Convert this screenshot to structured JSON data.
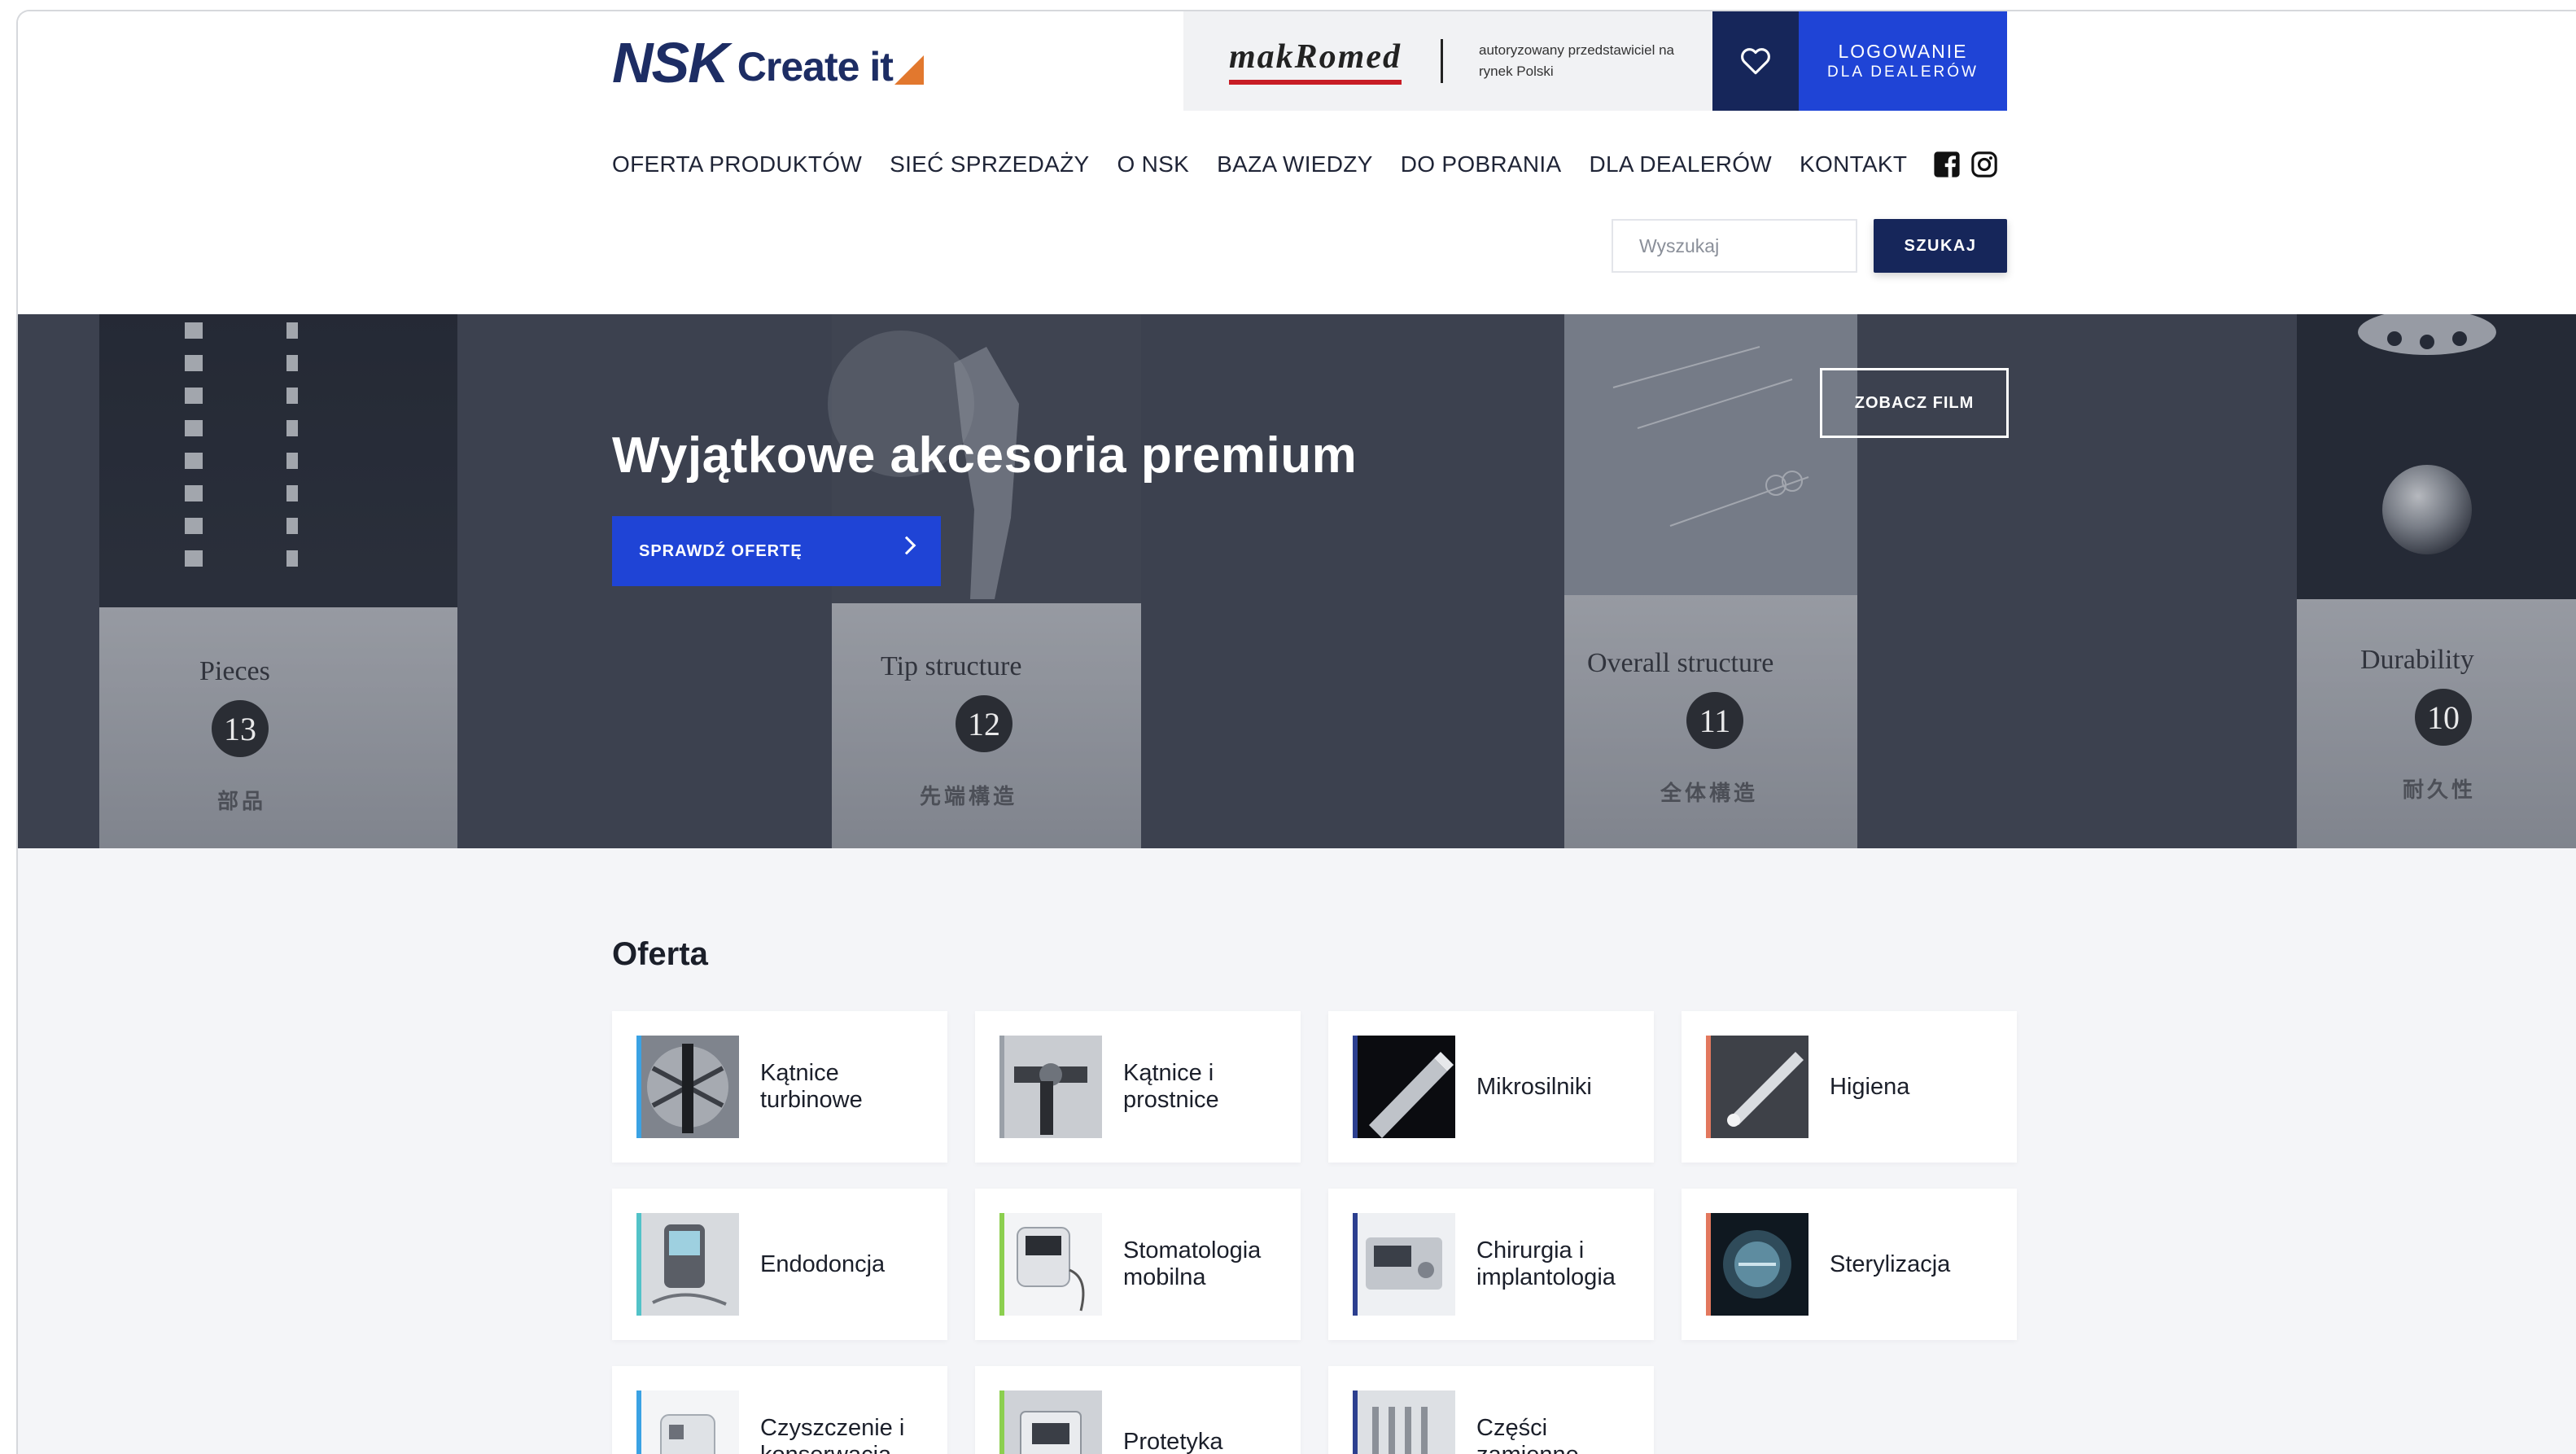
{
  "brand": {
    "logo_main": "NSK",
    "logo_sub": "Create it",
    "partner_logo": "makRomed",
    "partner_text": "autoryzowany przedstawiciel na rynek Polski"
  },
  "header": {
    "login_line1": "LOGOWANIE",
    "login_line2": "DLA DEALERÓW",
    "search_placeholder": "Wyszukaj",
    "search_button": "SZUKAJ"
  },
  "nav": {
    "items": [
      "OFERTA PRODUKTÓW",
      "SIEĆ SPRZEDAŻY",
      "O NSK",
      "BAZA WIEDZY",
      "DO POBRANIA",
      "DLA DEALERÓW",
      "KONTAKT"
    ]
  },
  "hero": {
    "title": "Wyjątkowe akcesoria premium",
    "cta": "SPRAWDŹ OFERTĘ",
    "film_button": "ZOBACZ FILM",
    "boxes": [
      {
        "label": "Pieces",
        "number": "13",
        "kanji": "部品"
      },
      {
        "label": "Tip structure",
        "number": "12",
        "kanji": "先端構造"
      },
      {
        "label": "Overall structure",
        "number": "11",
        "kanji": "全体構造"
      },
      {
        "label": "Durability",
        "number": "10",
        "kanji": "耐久性"
      }
    ]
  },
  "offer": {
    "title": "Oferta",
    "cards": [
      {
        "label": "Kątnice turbinowe",
        "accent": "#3aa2e4"
      },
      {
        "label": "Kątnice i prostnice",
        "accent": "#9aa0a8"
      },
      {
        "label": "Mikrosilniki",
        "accent": "#2c3f8f"
      },
      {
        "label": "Higiena",
        "accent": "#e2785e"
      },
      {
        "label": "Endodoncja",
        "accent": "#52c2c8"
      },
      {
        "label": "Stomatologia mobilna",
        "accent": "#8ccf4f"
      },
      {
        "label": "Chirurgia i implantologia",
        "accent": "#2c3f8f"
      },
      {
        "label": "Sterylizacja",
        "accent": "#e2785e"
      },
      {
        "label": "Czyszczenie i konserwacja",
        "accent": "#3aa2e4"
      },
      {
        "label": "Protetyka",
        "accent": "#8ccf4f"
      },
      {
        "label": "Części zamienne",
        "accent": "#2c3f8f"
      }
    ]
  },
  "colors": {
    "navy": "#16265a",
    "blue": "#1f44d6",
    "orange": "#e2782e",
    "offer_bg": "#f4f5f8"
  }
}
